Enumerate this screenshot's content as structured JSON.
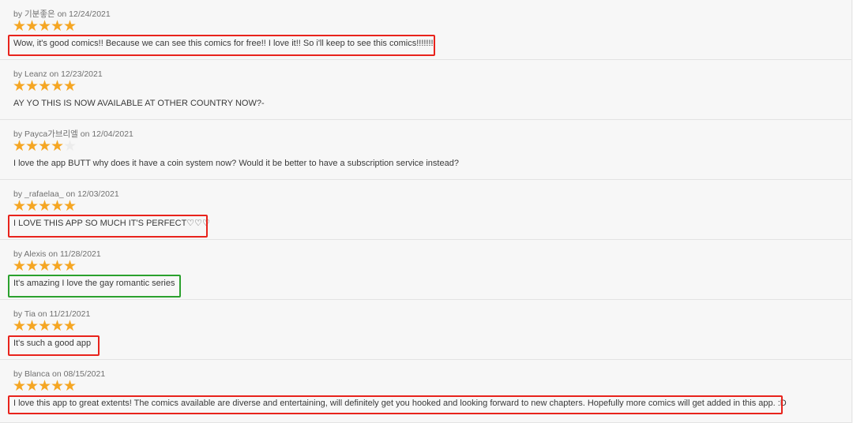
{
  "colors": {
    "star_filled": "#f5a623",
    "star_empty": "#ececec",
    "highlight_red": "#e8231c",
    "highlight_green": "#2ba12e"
  },
  "reviews": [
    {
      "meta": "by 기분좋은 on 12/24/2021",
      "stars": "5 of 5",
      "text": "Wow, it's good comics!! Because we can see this comics for free!! I love it!! So i'll keep to see this comics!!!!!!!!"
    },
    {
      "meta": "by Leanz on 12/23/2021",
      "stars": "5 of 5",
      "text": "AY YO THIS IS NOW AVAILABLE AT OTHER COUNTRY NOW?-"
    },
    {
      "meta": "by Payca가브리엘 on 12/04/2021",
      "stars": "4 of 5",
      "text": "I love the app BUTT why does it have a coin system now? Would it be better to have a subscription service instead?"
    },
    {
      "meta": "by _rafaelaa_ on 12/03/2021",
      "stars": "5 of 5",
      "text": "I LOVE THIS APP SO MUCH IT'S PERFECT♡♡♡"
    },
    {
      "meta": "by Alexis on 11/28/2021",
      "stars": "5 of 5",
      "text": "It's amazing I love the gay romantic series"
    },
    {
      "meta": "by Tia on 11/21/2021",
      "stars": "5 of 5",
      "text": "It's such a good app"
    },
    {
      "meta": "by Blanca on 08/15/2021",
      "stars": "5 of 5",
      "text": "I love this app to great extents! The comics available are diverse and entertaining, will definitely get you hooked and looking forward to new chapters. Hopefully more comics will get added in this app. :D"
    }
  ]
}
